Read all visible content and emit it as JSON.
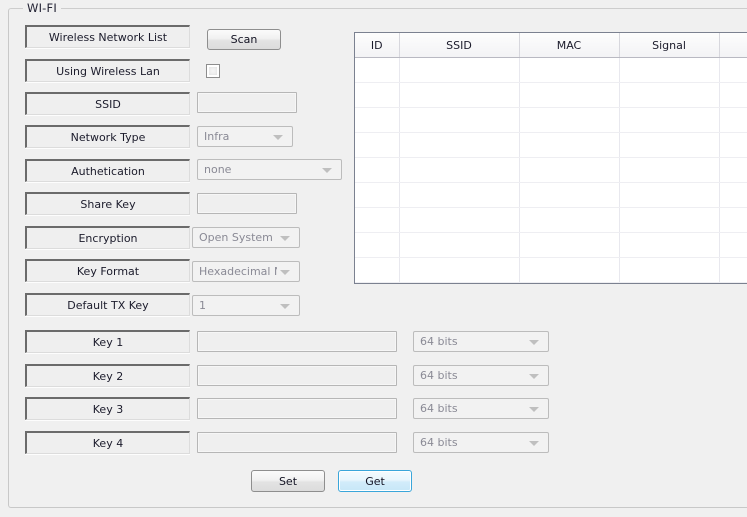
{
  "group": {
    "legend": "WI-FI"
  },
  "rows": [
    {
      "label": "Wireless Network List"
    },
    {
      "label": "Using Wireless Lan"
    },
    {
      "label": "SSID"
    },
    {
      "label": "Network Type"
    },
    {
      "label": "Authetication"
    },
    {
      "label": "Share Key"
    },
    {
      "label": "Encryption"
    },
    {
      "label": "Key Format"
    },
    {
      "label": "Default TX Key"
    },
    {
      "label": "Key 1"
    },
    {
      "label": "Key 2"
    },
    {
      "label": "Key 3"
    },
    {
      "label": "Key 4"
    }
  ],
  "scan_button": {
    "label": "Scan"
  },
  "using_wireless_lan": {
    "checked": false
  },
  "ssid_input": {
    "value": "",
    "placeholder": ""
  },
  "network_type": {
    "value": "Infra"
  },
  "authentication": {
    "value": "none"
  },
  "share_key_input": {
    "value": "",
    "placeholder": ""
  },
  "encryption": {
    "value": "Open System"
  },
  "key_format": {
    "value": "Hexadecimal Nur"
  },
  "default_tx_key": {
    "value": "1"
  },
  "keys": [
    {
      "label": "Key 1",
      "value": "",
      "bits": "64 bits"
    },
    {
      "label": "Key 2",
      "value": "",
      "bits": "64 bits"
    },
    {
      "label": "Key 3",
      "value": "",
      "bits": "64 bits"
    },
    {
      "label": "Key 4",
      "value": "",
      "bits": "64 bits"
    }
  ],
  "table": {
    "columns": [
      "ID",
      "SSID",
      "MAC",
      "Signal",
      ""
    ],
    "rows": []
  },
  "footer": {
    "set_label": "Set",
    "get_label": "Get"
  },
  "colors": {
    "window_background": "#f0f0f0",
    "primary_button_border": "#3aa6da",
    "plate_shadow": "#6b6b6b",
    "table_border": "#7b8190"
  }
}
